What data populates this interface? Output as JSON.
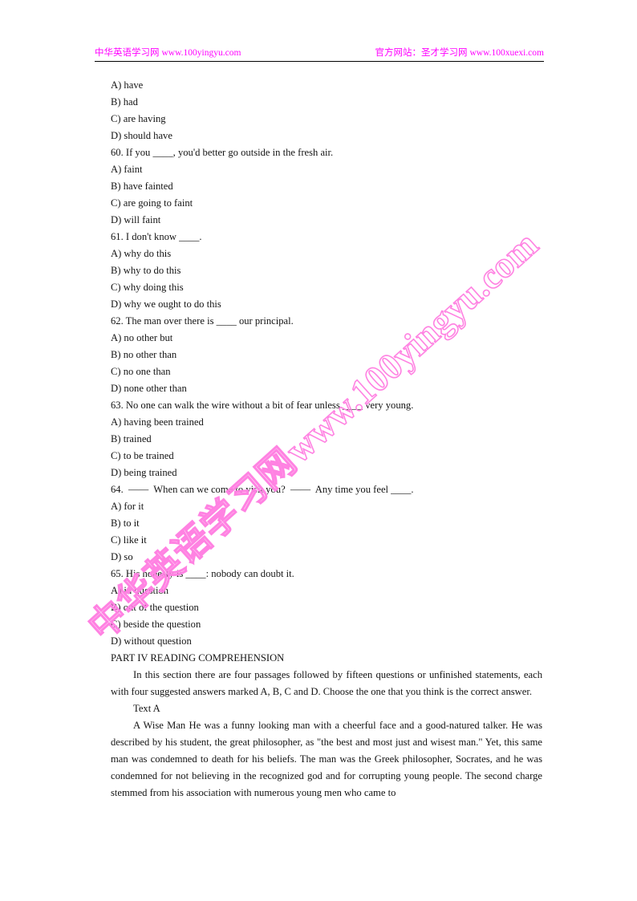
{
  "header": {
    "left_cn": "中华英语学习网",
    "left_url": "www.100yingyu.com",
    "right_cn": "官方网站：圣才学习网",
    "right_url": "www.100xuexi.com",
    "rule_color": "#000000",
    "text_color": "#ff00ff"
  },
  "watermark": {
    "cn_text": "中华英语学习网",
    "en_text": "www.100yingyu.com",
    "full_text": "中华英语学习网www.100yingyu.com",
    "color": "#ff82e2",
    "rotation_deg": -42
  },
  "content": {
    "lines": [
      {
        "id": "opt-59-a",
        "text": "A) have"
      },
      {
        "id": "opt-59-b",
        "text": "B) had"
      },
      {
        "id": "opt-59-c",
        "text": "C) are having"
      },
      {
        "id": "opt-59-d",
        "text": "D) should have"
      },
      {
        "id": "q-60",
        "text": "60. If you ____, you'd better go outside in the fresh air."
      },
      {
        "id": "opt-60-a",
        "text": "A) faint"
      },
      {
        "id": "opt-60-b",
        "text": "B) have fainted"
      },
      {
        "id": "opt-60-c",
        "text": "C) are going to faint"
      },
      {
        "id": "opt-60-d",
        "text": "D) will faint"
      },
      {
        "id": "q-61",
        "text": "61. I don't know ____."
      },
      {
        "id": "opt-61-a",
        "text": "A) why do this"
      },
      {
        "id": "opt-61-b",
        "text": "B) why to do this"
      },
      {
        "id": "opt-61-c",
        "text": "C) why doing this"
      },
      {
        "id": "opt-61-d",
        "text": "D) why we ought to do this"
      },
      {
        "id": "q-62",
        "text": "62. The man over there is ____ our principal."
      },
      {
        "id": "opt-62-a",
        "text": "A) no other but"
      },
      {
        "id": "opt-62-b",
        "text": "B) no other than"
      },
      {
        "id": "opt-62-c",
        "text": "C) no one than"
      },
      {
        "id": "opt-62-d",
        "text": "D) none other than"
      },
      {
        "id": "q-63",
        "text": "63. No one can walk the wire without a bit of fear unless ____ very young."
      },
      {
        "id": "opt-63-a",
        "text": "A) having been trained"
      },
      {
        "id": "opt-63-b",
        "text": "B) trained"
      },
      {
        "id": "opt-63-c",
        "text": "C) to be trained"
      },
      {
        "id": "opt-63-d",
        "text": "D) being trained"
      },
      {
        "id": "q-64",
        "text": "64.  ——  When can we come to visit you?  ——  Any time you feel ____."
      },
      {
        "id": "opt-64-a",
        "text": "A) for it"
      },
      {
        "id": "opt-64-b",
        "text": "B) to it"
      },
      {
        "id": "opt-64-c",
        "text": "C) like it"
      },
      {
        "id": "opt-64-d",
        "text": "D) so"
      },
      {
        "id": "q-65",
        "text": "65. His honesty is ____: nobody can doubt it."
      },
      {
        "id": "opt-65-a",
        "text": "A) in question"
      },
      {
        "id": "opt-65-b",
        "text": "B) out of the question"
      },
      {
        "id": "opt-65-c",
        "text": "C) beside the question"
      },
      {
        "id": "opt-65-d",
        "text": "D) without question"
      }
    ],
    "part_heading": "PART IV READING COMPREHENSION",
    "directions": "In this section there are four passages followed by fifteen questions or unfinished statements, each with four suggested answers marked A, B, C and D. Choose the one that you think is the correct answer.",
    "text_label": "Text A",
    "passage": "A Wise Man He was a funny looking man with a cheerful face and a good-natured talker. He was described by his student, the great philosopher, as \"the best and most just and wisest man.\" Yet, this same man was condemned to death for his beliefs. The man was the Greek philosopher, Socrates, and he was condemned for not believing in the recognized god and for corrupting young people. The second charge stemmed from his association with numerous young men who came to"
  }
}
